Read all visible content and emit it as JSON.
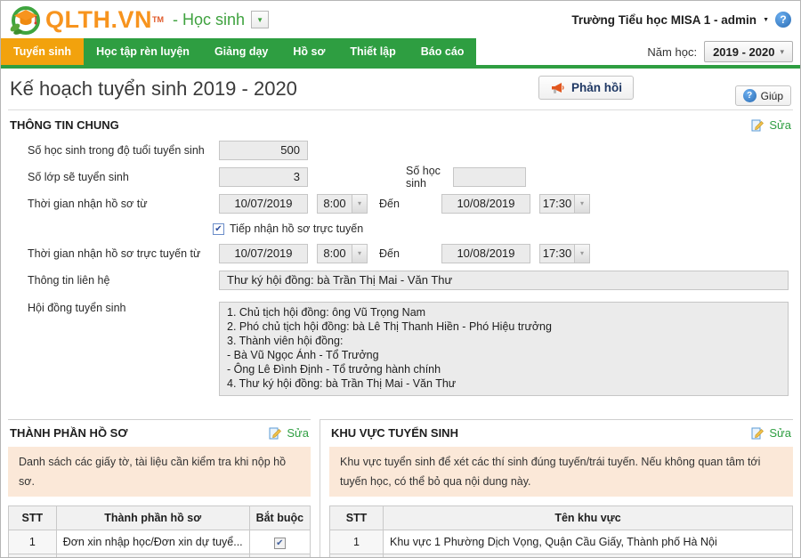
{
  "colors": {
    "nav_green": "#2e9e41",
    "active_tab_orange": "#f2a20d",
    "logo_orange": "#f7941e",
    "edit_link_green": "#2e9e41",
    "info_box_bg": "#fbe8d8",
    "feedback_text": "#1f3864"
  },
  "header": {
    "logo_text": "QLTH.VN",
    "logo_tm": "TM",
    "module_label": "- Học sinh",
    "account_label": "Trường Tiểu học MISA 1 - admin"
  },
  "nav": {
    "tabs": [
      {
        "label": "Tuyển sinh"
      },
      {
        "label": "Học tập rèn luyện"
      },
      {
        "label": "Giảng dạy"
      },
      {
        "label": "Hồ sơ"
      },
      {
        "label": "Thiết lập"
      },
      {
        "label": "Báo cáo"
      }
    ],
    "school_year_label": "Năm học:",
    "school_year_value": "2019 - 2020"
  },
  "page": {
    "title": "Kế hoạch tuyển sinh 2019 - 2020",
    "feedback_button_label": "Phản hồi",
    "help_button_label": "Giúp"
  },
  "general": {
    "section_title": "THÔNG TIN CHUNG",
    "edit_label": "Sửa",
    "age_label": "Số học sinh trong độ tuổi tuyển sinh",
    "age_value": "500",
    "class_label": "Số lớp sẽ tuyển sinh",
    "class_value": "3",
    "students_label": "Số học sinh",
    "students_value": "",
    "receive_label": "Thời gian nhận hồ sơ từ",
    "receive_from_date": "10/07/2019",
    "receive_from_time": "8:00",
    "den_label": "Đến",
    "receive_to_date": "10/08/2019",
    "receive_to_time": "17:30",
    "online_checkbox_label": "Tiếp nhận hồ sơ trực tuyến",
    "online_label": "Thời gian nhận hồ sơ trực tuyến từ",
    "online_from_date": "10/07/2019",
    "online_from_time": "8:00",
    "online_den_label": "Đến",
    "online_to_date": "10/08/2019",
    "online_to_time": "17:30",
    "contact_label": "Thông tin liên hệ",
    "contact_value": "Thư ký hội đồng: bà Trần Thị Mai - Văn Thư",
    "council_label": "Hội đồng tuyển sinh",
    "council_value": "1. Chủ tịch hội đồng: ông Vũ Trọng Nam\n2. Phó chủ tịch hội đồng: bà Lê Thị Thanh Hiền - Phó Hiệu trưởng\n3. Thành viên hội đồng:\n- Bà Vũ Ngọc Ánh - Tổ Trưởng\n- Ông Lê Đình Định - Tổ trưởng hành chính\n4. Thư ký hội đồng: bà Trần Thị Mai - Văn Thư"
  },
  "dossier": {
    "section_title": "THÀNH PHẦN HỒ SƠ",
    "edit_label": "Sửa",
    "info_text": "Danh sách các giấy tờ, tài liệu cần kiểm tra khi nộp hồ sơ.",
    "headers": [
      "STT",
      "Thành phần hồ sơ",
      "Bắt buộc"
    ],
    "rows": [
      {
        "stt": "1",
        "name": "Đơn xin nhập học/Đơn xin dự tuyể...",
        "required": true
      }
    ]
  },
  "area": {
    "section_title": "KHU VỰC TUYỂN SINH",
    "edit_label": "Sửa",
    "info_text": "Khu vực tuyển sinh để xét các thí sinh đúng tuyến/trái tuyến. Nếu không quan tâm tới tuyến học, có thể bỏ qua nội dung này.",
    "headers": [
      "STT",
      "Tên khu vực"
    ],
    "rows": [
      {
        "stt": "1",
        "name": "Khu vực 1 Phường Dịch Vọng, Quận Cầu Giấy, Thành phố Hà Nội"
      }
    ]
  }
}
